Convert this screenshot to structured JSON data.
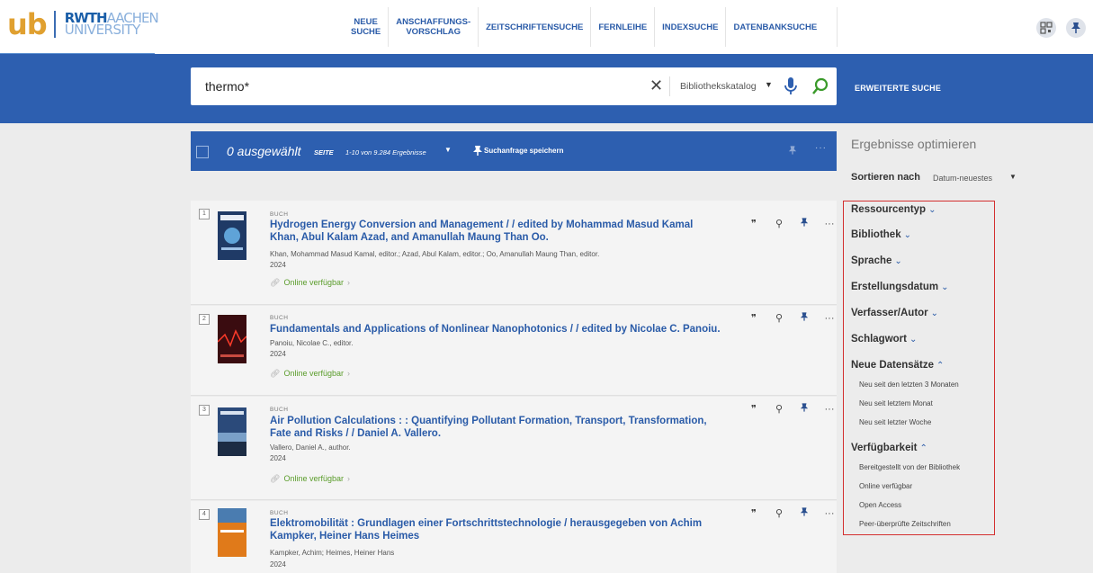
{
  "logo": {
    "ub": "ub",
    "rwth": "RWTH",
    "aachen": "AACHEN",
    "university": "UNIVERSITY"
  },
  "nav": [
    {
      "l1": "NEUE",
      "l2": "SUCHE"
    },
    {
      "l1": "ANSCHAFFUNGS-",
      "l2": "VORSCHLAG"
    },
    {
      "l1": "ZEITSCHRIFTENSUCHE",
      "l2": ""
    },
    {
      "l1": "FERNLEIHE",
      "l2": ""
    },
    {
      "l1": "INDEXSUCHE",
      "l2": ""
    },
    {
      "l1": "DATENBANKSUCHE",
      "l2": ""
    }
  ],
  "search": {
    "value": "thermo*",
    "clear": "✕",
    "scope": "Bibliothekskatalog",
    "advanced": "ERWEITERTE SUCHE"
  },
  "toolbar": {
    "selected": "0 ausgewählt",
    "page_label": "SEITE",
    "range": "1-10 von 9.284 Ergebnisse",
    "save": "Suchanfrage speichern",
    "more": "···"
  },
  "results": [
    {
      "num": "1",
      "type": "BUCH",
      "title": "Hydrogen Energy Conversion and Management / / edited by Mohammad Masud Kamal Khan, Abul Kalam Azad, and Amanullah Maung Than Oo.",
      "authors": "Khan, Mohammad Masud Kamal, editor.; Azad, Abul Kalam, editor.; Oo, Amanullah Maung Than, editor.",
      "year": "2024",
      "availability": "Online verfügbar"
    },
    {
      "num": "2",
      "type": "BUCH",
      "title": "Fundamentals and Applications of Nonlinear Nanophotonics / / edited by Nicolae C. Panoiu.",
      "authors": "Panoiu, Nicolae C., editor.",
      "year": "2024",
      "availability": "Online verfügbar"
    },
    {
      "num": "3",
      "type": "BUCH",
      "title": "Air Pollution Calculations : : Quantifying Pollutant Formation, Transport, Transformation, Fate and Risks / / Daniel A. Vallero.",
      "authors": "Vallero, Daniel A., author.",
      "year": "2024",
      "availability": "Online verfügbar"
    },
    {
      "num": "4",
      "type": "BUCH",
      "title": "Elektromobilität : Grundlagen einer Fortschrittstechnologie / herausgegeben von Achim Kampker, Heiner Hans Heimes",
      "authors": "Kampker, Achim; Heimes, Heiner Hans",
      "year": "2024",
      "availability": ""
    }
  ],
  "panel": {
    "title": "Ergebnisse optimieren",
    "sort_label": "Sortieren nach",
    "sort_value": "Datum-neuestes",
    "facets": {
      "ressourcentyp": "Ressourcentyp",
      "bibliothek": "Bibliothek",
      "sprache": "Sprache",
      "erstellungsdatum": "Erstellungsdatum",
      "verfasser": "Verfasser/Autor",
      "schlagwort": "Schlagwort",
      "neue": "Neue Datensätze",
      "verfuegbarkeit": "Verfügbarkeit"
    },
    "neue_items": [
      "Neu seit den letzten 3 Monaten",
      "Neu seit letztem Monat",
      "Neu seit letzter Woche"
    ],
    "verf_items": [
      "Bereitgestellt von der Bibliothek",
      "Online verfügbar",
      "Open Access",
      "Peer-überprüfte Zeitschriften"
    ]
  },
  "colors": {
    "brand_blue": "#2d5fb0",
    "link_blue": "#2a5ba8",
    "online_green": "#5a9c2a",
    "highlight_red": "#d32f2f",
    "logo_orange": "#e0a030"
  },
  "icons": [
    "qr-code-icon",
    "pin-icon",
    "clear-icon",
    "microphone-icon",
    "search-icon",
    "quote-icon",
    "link-icon",
    "more-icon",
    "chevron-down-icon",
    "chevron-up-icon"
  ]
}
